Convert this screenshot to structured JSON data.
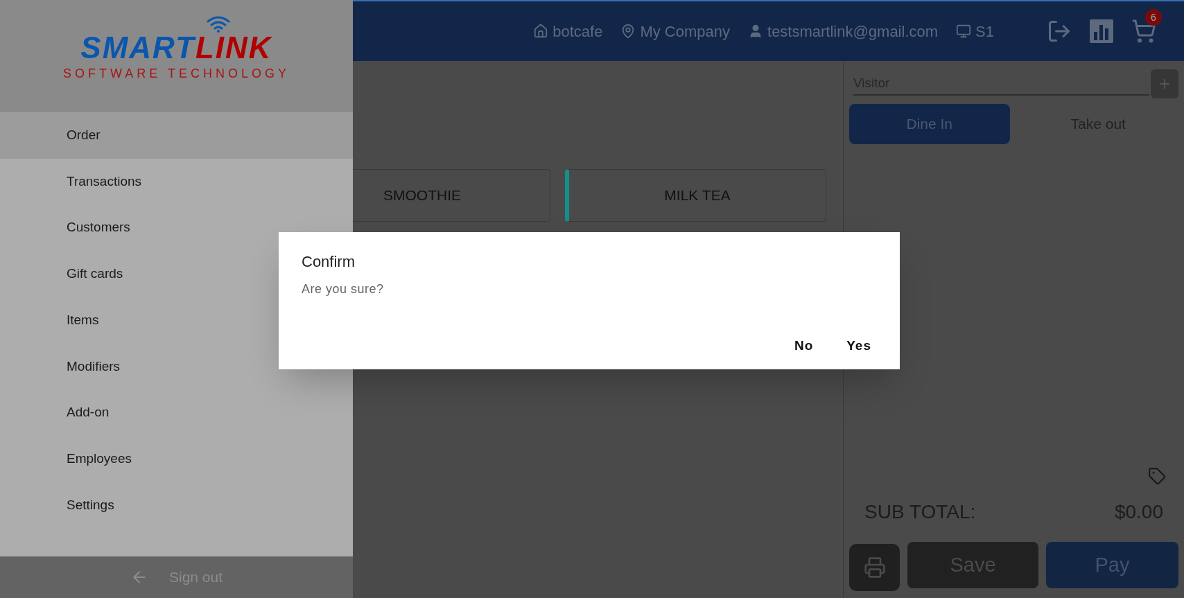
{
  "header": {
    "store": "botcafe",
    "company": "My Company",
    "user": "testsmartlink@gmail.com",
    "station": "S1",
    "cart_count": "6"
  },
  "categories": [
    {
      "label": "SMOOTHIE"
    },
    {
      "label": "MILK TEA",
      "color": "#148f8a"
    }
  ],
  "order_panel": {
    "customer_placeholder": "Visitor",
    "tabs": [
      {
        "label": "Dine In",
        "selected": true
      },
      {
        "label": "Take out",
        "selected": false
      }
    ],
    "subtotal_label": "SUB TOTAL:",
    "subtotal_value": "$0.00",
    "save": "Save",
    "pay": "Pay"
  },
  "drawer": {
    "logo": {
      "primary": "SMART",
      "accent": "LINK",
      "tagline": "SOFTWARE TECHNOLOGY"
    },
    "items": [
      {
        "label": "Order",
        "selected": true
      },
      {
        "label": "Transactions",
        "selected": false
      },
      {
        "label": "Customers",
        "selected": false
      },
      {
        "label": "Gift cards",
        "selected": false
      },
      {
        "label": "Items",
        "selected": false
      },
      {
        "label": "Modifiers",
        "selected": false
      },
      {
        "label": "Add-on",
        "selected": false
      },
      {
        "label": "Employees",
        "selected": false
      },
      {
        "label": "Settings",
        "selected": false
      }
    ],
    "sign_out": "Sign out"
  },
  "dialog": {
    "title": "Confirm",
    "message": "Are you sure?",
    "buttons": [
      "No",
      "Yes"
    ]
  }
}
